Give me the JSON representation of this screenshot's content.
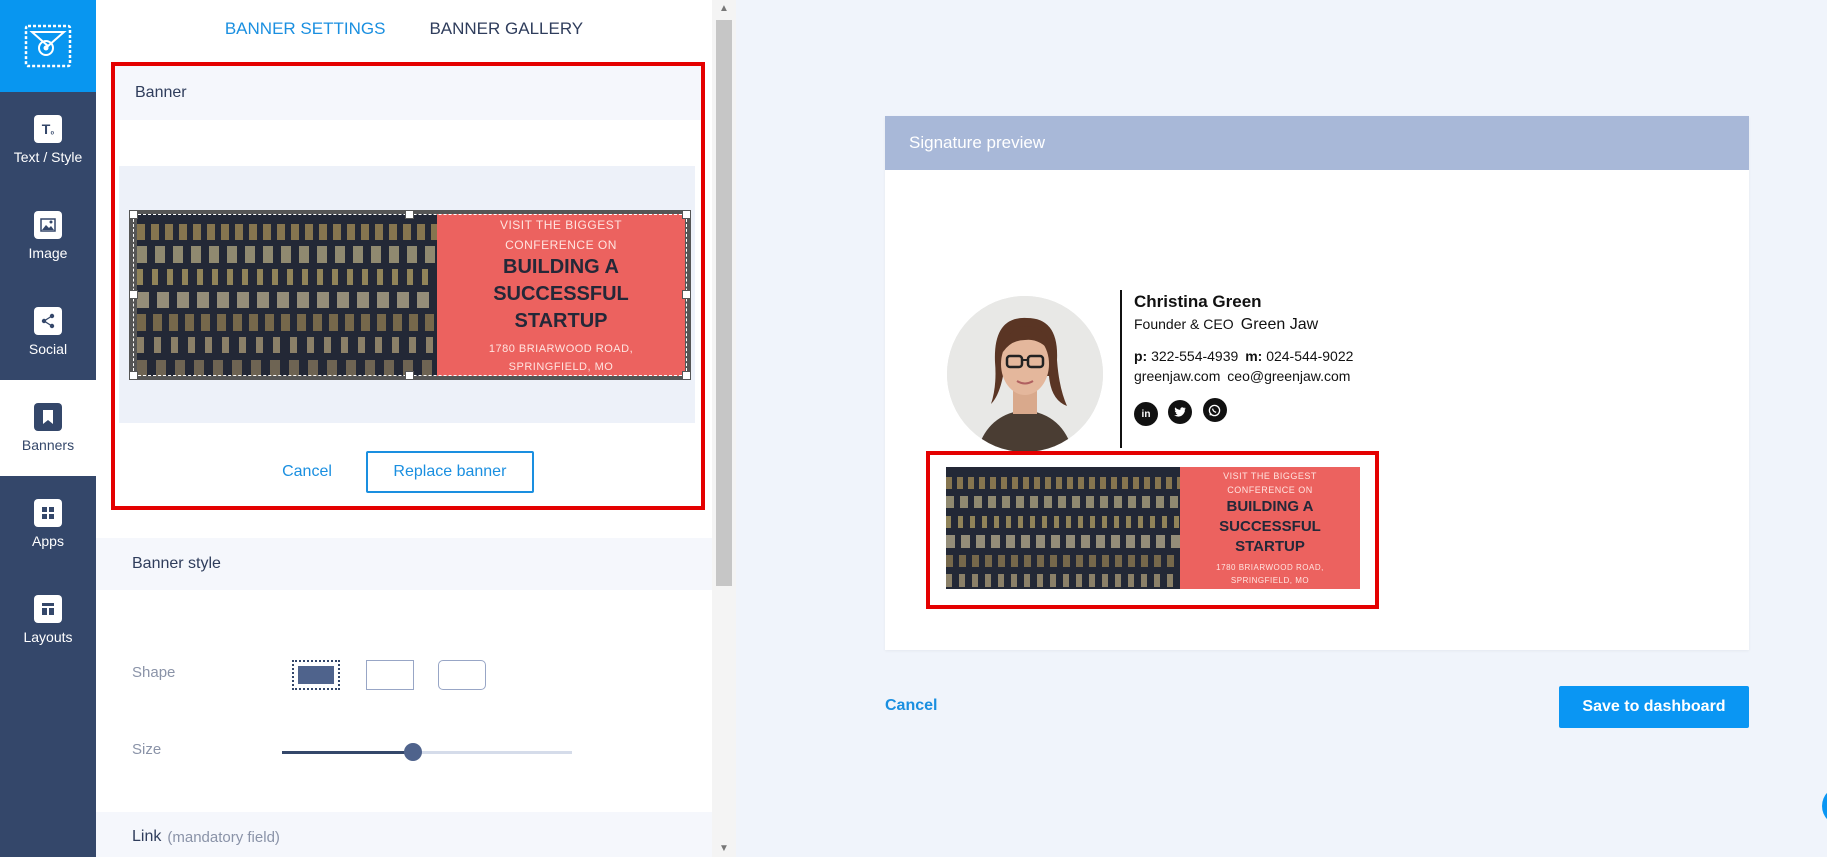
{
  "nav": {
    "items": [
      {
        "label": "Text / Style",
        "icon": "text-style-icon"
      },
      {
        "label": "Image",
        "icon": "image-icon"
      },
      {
        "label": "Social",
        "icon": "share-icon"
      },
      {
        "label": "Banners",
        "icon": "bookmark-icon",
        "active": true
      },
      {
        "label": "Apps",
        "icon": "apps-grid-icon"
      },
      {
        "label": "Layouts",
        "icon": "layouts-icon"
      }
    ]
  },
  "tabs": [
    {
      "label": "BANNER SETTINGS",
      "active": true
    },
    {
      "label": "BANNER GALLERY",
      "active": false
    }
  ],
  "banner_section": {
    "title": "Banner",
    "cancel_label": "Cancel",
    "replace_label": "Replace banner"
  },
  "banner_image": {
    "line1": "VISIT THE BIGGEST",
    "line2": "CONFERENCE ON",
    "headline1": "BUILDING A",
    "headline2": "SUCCESSFUL",
    "headline3": "STARTUP",
    "address1": "1780  BRIARWOOD ROAD,",
    "address2": "SPRINGFIELD, MO"
  },
  "banner_style": {
    "title": "Banner style",
    "shape_label": "Shape",
    "size_label": "Size",
    "size_value_fraction": 0.45
  },
  "link_section": {
    "title": "Link",
    "note": "(mandatory field)"
  },
  "preview": {
    "title": "Signature preview",
    "name": "Christina Green",
    "role": "Founder & CEO",
    "company": "Green Jaw",
    "phone_label": "p:",
    "phone": "322-554-4939",
    "mobile_label": "m:",
    "mobile": "024-544-9022",
    "website": "greenjaw.com",
    "email": "ceo@greenjaw.com",
    "social": [
      "linkedin-icon",
      "twitter-icon",
      "whatsapp-icon"
    ]
  },
  "footer": {
    "cancel_label": "Cancel",
    "save_label": "Save to dashboard"
  },
  "colors": {
    "accent": "#0a96f3",
    "nav_bg": "#34476a",
    "highlight": "#e40000",
    "banner_red": "#ec625f"
  }
}
